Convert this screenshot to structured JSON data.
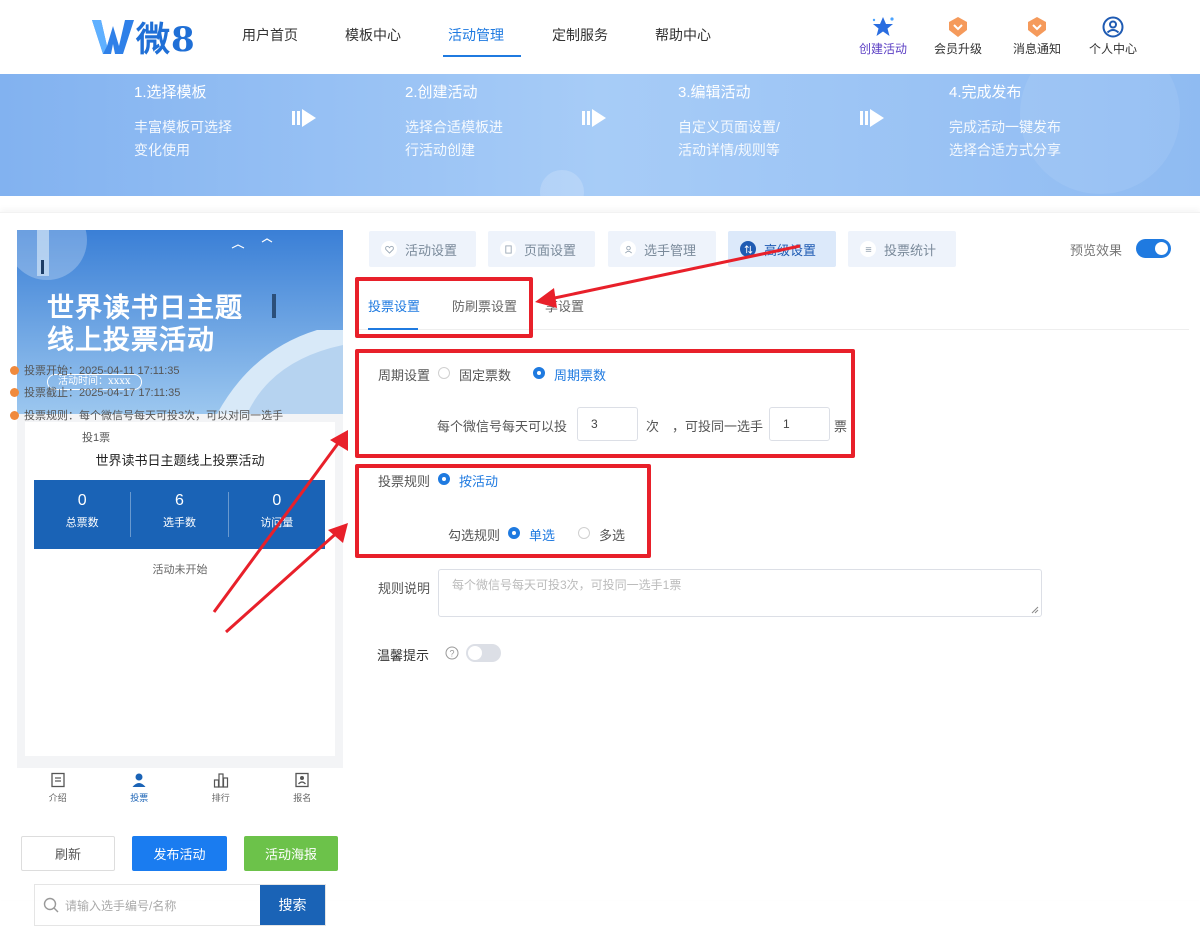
{
  "header": {
    "logo_text": "微8",
    "nav": [
      "用户首页",
      "模板中心",
      "活动管理",
      "定制服务",
      "帮助中心"
    ],
    "active_nav": "活动管理",
    "actions": [
      {
        "label": "创建活动",
        "icon": "star-icon"
      },
      {
        "label": "会员升级",
        "icon": "vip-badge-icon"
      },
      {
        "label": "消息通知",
        "icon": "message-badge-icon"
      },
      {
        "label": "个人中心",
        "icon": "user-circle-icon"
      }
    ]
  },
  "banner": {
    "steps": [
      {
        "title": "1.选择模板",
        "line1": "丰富模板可选择",
        "line2": "变化使用"
      },
      {
        "title": "2.创建活动",
        "line1": "选择合适模板进",
        "line2": "行活动创建"
      },
      {
        "title": "3.编辑活动",
        "line1": "自定义页面设置/",
        "line2": "活动详情/规则等"
      },
      {
        "title": "4.完成发布",
        "line1": "完成活动一键发布",
        "line2": "选择合适方式分享"
      }
    ]
  },
  "preview": {
    "poster_title_1": "世界读书日主题",
    "poster_title_2": "线上投票活动",
    "poster_time": "活动时间：xxxx",
    "activity_name": "世界读书日主题线上投票活动",
    "stats": [
      {
        "value": "0",
        "label": "总票数"
      },
      {
        "value": "6",
        "label": "选手数"
      },
      {
        "value": "0",
        "label": "访问量"
      }
    ],
    "status": "活动未开始",
    "vote_start": "投票开始：2025-04-11 17:11:35",
    "vote_end": "投票截止：2025-04-17 17:11:35",
    "vote_rule_1": "投票规则：每个微信号每天可投3次，可以对同一选手",
    "vote_rule_2": "投1票",
    "search_placeholder": "请输入选手编号/名称",
    "search_button": "搜索",
    "tabbar": [
      "介绍",
      "投票",
      "排行",
      "报名"
    ],
    "active_tab": "投票"
  },
  "bottom_buttons": {
    "refresh": "刷新",
    "publish": "发布活动",
    "poster": "活动海报"
  },
  "settings": {
    "top_tabs": [
      "活动设置",
      "页面设置",
      "选手管理",
      "高级设置",
      "投票统计"
    ],
    "active_top_tab": "高级设置",
    "preview_label": "预览效果",
    "preview_on": true,
    "sub_tabs": [
      "投票设置",
      "防刷票设置",
      "分享设置"
    ],
    "sub_tab_visible_3": "享设置",
    "active_sub_tab": "投票设置",
    "cycle_label": "周期设置",
    "cycle_options": [
      "固定票数",
      "周期票数"
    ],
    "cycle_selected": "周期票数",
    "per_day_prefix": "每个微信号每天可以投",
    "per_day_value": "3",
    "times_unit": "次",
    "same_player_prefix": "，可投同一选手",
    "same_player_value": "1",
    "votes_unit": "票",
    "vote_rule_label": "投票规则",
    "vote_rule_option": "按活动",
    "select_rule_label": "勾选规则",
    "select_options": [
      "单选",
      "多选"
    ],
    "select_selected": "单选",
    "rule_desc_label": "规则说明",
    "rule_desc_placeholder": "每个微信号每天可投3次，可投同一选手1票",
    "tip_label": "温馨提示",
    "tip_on": false
  },
  "colors": {
    "brand": "#1f7ae0",
    "dark_blue": "#1a63b6",
    "green": "#6cc24a",
    "annotation_red": "#e8202a"
  }
}
